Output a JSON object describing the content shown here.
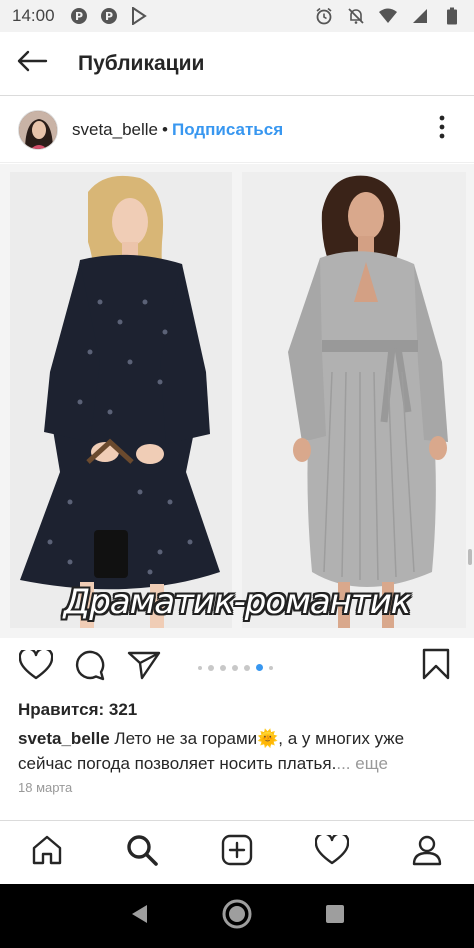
{
  "status_bar": {
    "time": "14:00",
    "left_icons": [
      "pinterest-icon",
      "pinterest-icon",
      "play-store-icon"
    ],
    "right_icons": [
      "alarm-icon",
      "mute-icon",
      "wifi-icon",
      "signal-icon",
      "battery-icon"
    ]
  },
  "header": {
    "title": "Публикации",
    "back_icon": "arrow-left-icon"
  },
  "post": {
    "username": "sveta_belle",
    "separator": "•",
    "follow_label": "Подписаться",
    "image_caption": "Драматик-романтик",
    "likes": "Нравится: 321",
    "caption_user": "sveta_belle",
    "caption_text": " Лето не за горами🌞, а у многих уже сейчас погода позволяет носить платья.",
    "caption_more": "... еще",
    "date": "18 марта",
    "carousel": {
      "count": 7,
      "active_index": 5
    }
  },
  "colors": {
    "accent": "#3897f0",
    "text": "#262626",
    "muted": "#999999"
  },
  "bottom_nav": [
    "home-icon",
    "search-icon",
    "add-post-icon",
    "heart-icon",
    "profile-icon"
  ],
  "system_nav": [
    "back-triangle-icon",
    "home-circle-icon",
    "recents-square-icon"
  ]
}
